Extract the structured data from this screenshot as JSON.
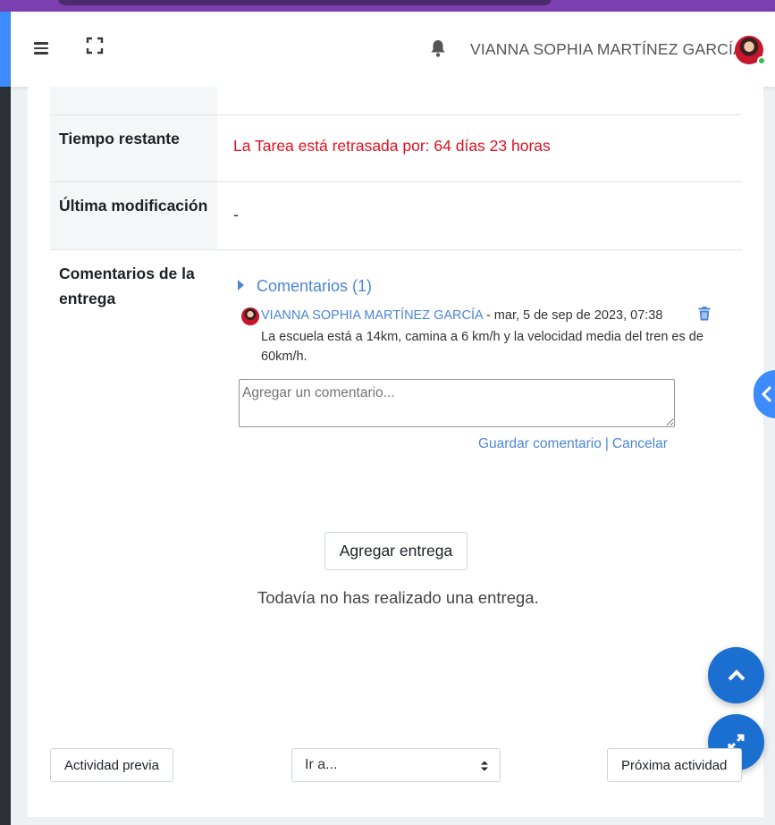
{
  "header": {
    "username": "VIANNA SOPHIA MARTÍNEZ GARCÍA",
    "icons": [
      "hamburger-icon",
      "fullscreen-icon",
      "bell-icon",
      "avatar"
    ]
  },
  "rows": {
    "remaining": {
      "label": "Tiempo restante",
      "value": "La Tarea está retrasada por: 64 días 23 horas"
    },
    "last_modified": {
      "label": "Última modificación",
      "value": "-"
    },
    "comments": {
      "label": "Comentarios de la entrega"
    }
  },
  "comments": {
    "toggle_label": "Comentarios (1)",
    "items": [
      {
        "author": "VIANNA SOPHIA MARTÍNEZ GARCÍA",
        "date": "- mar, 5 de sep de 2023, 07:38",
        "text": "La escuela está a 14km, camina a 6 km/h y la velocidad media del tren es de 60km/h."
      }
    ],
    "input_placeholder": "Agregar un comentario...",
    "save_label": "Guardar comentario",
    "separator": "|",
    "cancel_label": "Cancelar"
  },
  "submission": {
    "add_button": "Agregar entrega",
    "status": "Todavía no has realizado una entrega."
  },
  "navigation": {
    "prev_label": "Actividad previa",
    "goto_label": "Ir a...",
    "next_label": "Próxima actividad"
  },
  "colors": {
    "accent": "#4b86d6",
    "overdue": "#e0101e",
    "fab": "#1a6fd1",
    "topbar": "#7c3fb0"
  }
}
